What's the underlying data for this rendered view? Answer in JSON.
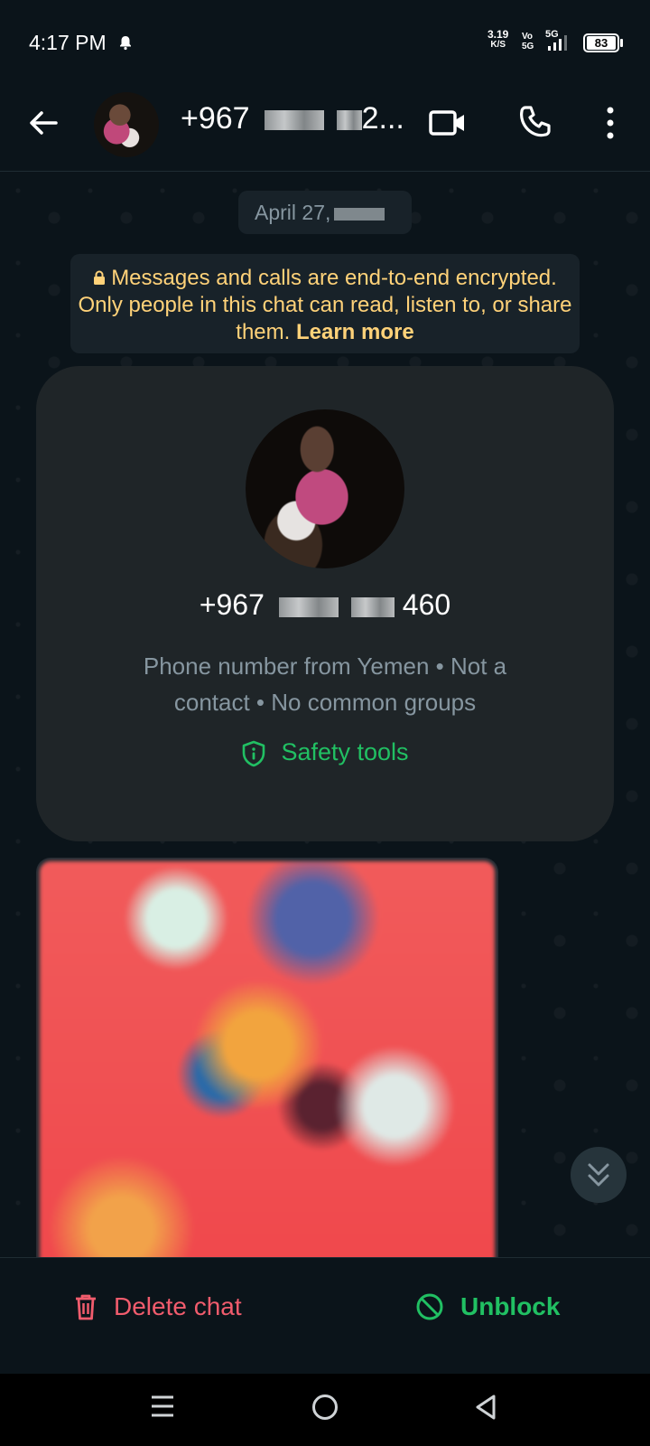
{
  "status_bar": {
    "time": "4:17 PM",
    "net_speed_value": "3.19",
    "net_speed_unit": "K/S",
    "network_top": "Vo",
    "network_bottom": "5G",
    "network_type": "5G",
    "battery": "83"
  },
  "header": {
    "contact_prefix": "+967",
    "contact_suffix": "2...",
    "icons": [
      "back-arrow-icon",
      "video-call-icon",
      "phone-icon",
      "more-vert-icon"
    ]
  },
  "chat": {
    "date_label": "April 27,",
    "encryption_notice": "Messages and calls are end-to-end encrypted. Only people in this chat can read, listen to, or share them.",
    "learn_more": "Learn more",
    "profile": {
      "number_prefix": "+967",
      "number_suffix": "460",
      "info": "Phone number from Yemen • Not a contact • No common groups",
      "safety_tools": "Safety tools"
    }
  },
  "actions": {
    "delete_chat": "Delete chat",
    "unblock": "Unblock"
  },
  "colors": {
    "background": "#0b141a",
    "accent_green": "#21c063",
    "danger_red": "#f15c6d",
    "notice_yellow": "#ffd279"
  }
}
